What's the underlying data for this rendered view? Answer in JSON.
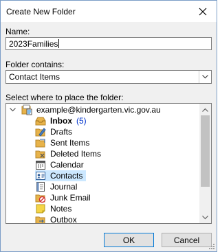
{
  "window": {
    "title": "Create New Folder"
  },
  "name_field": {
    "label": "Name:",
    "value": "2023Families"
  },
  "folder_contains": {
    "label": "Folder contains:",
    "selected": "Contact Items"
  },
  "tree": {
    "label": "Select where to place the folder:",
    "account": "example@kindergarten.vic.gov.au",
    "items": [
      {
        "label": "Inbox",
        "count": "(5)",
        "icon": "inbox-icon"
      },
      {
        "label": "Drafts",
        "icon": "drafts-icon"
      },
      {
        "label": "Sent Items",
        "icon": "sent-items-icon"
      },
      {
        "label": "Deleted Items",
        "icon": "deleted-items-icon"
      },
      {
        "label": "Calendar",
        "icon": "calendar-icon"
      },
      {
        "label": "Contacts",
        "icon": "contacts-icon"
      },
      {
        "label": "Journal",
        "icon": "journal-icon"
      },
      {
        "label": "Junk Email",
        "icon": "junk-email-icon"
      },
      {
        "label": "Notes",
        "icon": "notes-icon"
      },
      {
        "label": "Outbox",
        "icon": "outbox-icon"
      }
    ]
  },
  "buttons": {
    "ok": "OK",
    "cancel": "Cancel"
  },
  "colors": {
    "selection": "#cce8ff",
    "count": "#0033cc",
    "folder": "#e8b34a"
  }
}
